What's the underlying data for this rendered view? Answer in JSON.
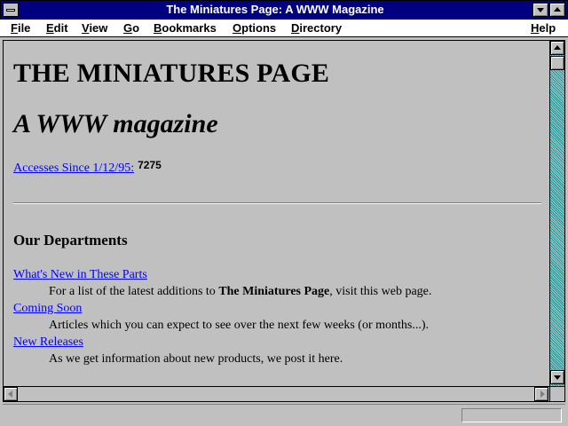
{
  "window": {
    "title": "The Miniatures Page: A WWW Magazine"
  },
  "menu": {
    "items": [
      {
        "key": "F",
        "rest": "ile"
      },
      {
        "key": "E",
        "rest": "dit"
      },
      {
        "key": "V",
        "rest": "iew"
      },
      {
        "key": "G",
        "rest": "o"
      },
      {
        "key": "B",
        "rest": "ookmarks"
      },
      {
        "key": "O",
        "rest": "ptions"
      },
      {
        "key": "D",
        "rest": "irectory"
      },
      {
        "key": "H",
        "rest": "elp"
      }
    ]
  },
  "page": {
    "heading": "THE MINIATURES PAGE",
    "subheading": "A WWW magazine",
    "accesses_link": "Accesses Since 1/12/95:",
    "accesses_count": "7275",
    "departments_title": "Our Departments",
    "departments": [
      {
        "link": "What's New in These Parts",
        "desc_before": "For a list of the latest additions to ",
        "desc_bold": "The Miniatures Page",
        "desc_after": ", visit this web page."
      },
      {
        "link": "Coming Soon",
        "desc_before": "Articles which you can expect to see over the next few weeks (or months...).",
        "desc_bold": "",
        "desc_after": ""
      },
      {
        "link": "New Releases",
        "desc_before": "As we get information about new products, we post it here.",
        "desc_bold": "",
        "desc_after": ""
      }
    ]
  },
  "colors": {
    "titlebar": "#000080",
    "link": "#0000ff",
    "scroll_track": "#00a0a0",
    "background": "#c0c0c0"
  },
  "icons": [
    "system-menu-icon",
    "minimize-icon",
    "maximize-icon",
    "scroll-up-icon",
    "scroll-down-icon",
    "scroll-left-icon",
    "scroll-right-icon"
  ]
}
